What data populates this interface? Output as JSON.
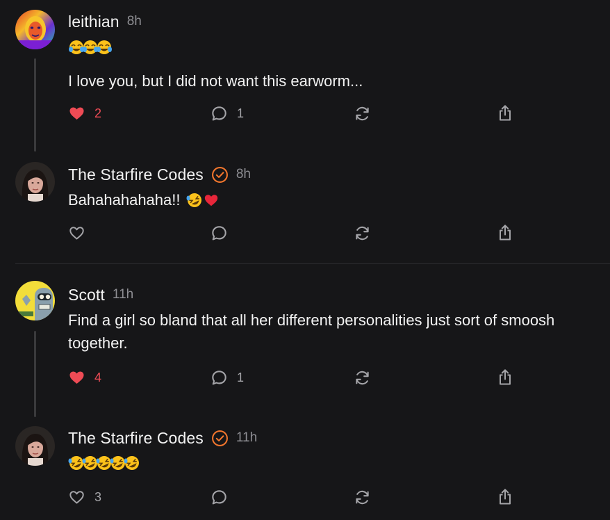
{
  "colors": {
    "background": "#161618",
    "like_active": "#ee4b55",
    "verified_orange": "#f2762d",
    "muted": "#8e8e93"
  },
  "posts": [
    {
      "username": "leithian",
      "time": "8h",
      "verified": false,
      "emoji_line": [
        "face-with-tears-of-joy",
        "face-with-tears-of-joy",
        "face-with-tears-of-joy"
      ],
      "text": "I love you, but I did not want this earworm...",
      "likes": "2",
      "liked": true,
      "replies": "1",
      "icons": [
        "heart-icon",
        "reply-icon",
        "repost-icon",
        "share-icon"
      ]
    },
    {
      "username": "The Starfire Codes",
      "time": "8h",
      "verified": true,
      "text": "Bahahahahaha!!",
      "text_emoji": [
        "rolling-on-floor-laughing",
        "red-heart"
      ],
      "likes": "",
      "liked": false,
      "replies": ""
    },
    {
      "username": "Scott",
      "time": "11h",
      "verified": false,
      "text": "Find a girl so bland that all her different personalities just sort of smoosh together.",
      "likes": "4",
      "liked": true,
      "replies": "1"
    },
    {
      "username": "The Starfire Codes",
      "time": "11h",
      "verified": true,
      "emoji_line": [
        "rolling-on-floor-laughing",
        "rolling-on-floor-laughing",
        "rolling-on-floor-laughing",
        "rolling-on-floor-laughing",
        "rolling-on-floor-laughing"
      ],
      "likes": "3",
      "liked": false,
      "replies": ""
    }
  ]
}
